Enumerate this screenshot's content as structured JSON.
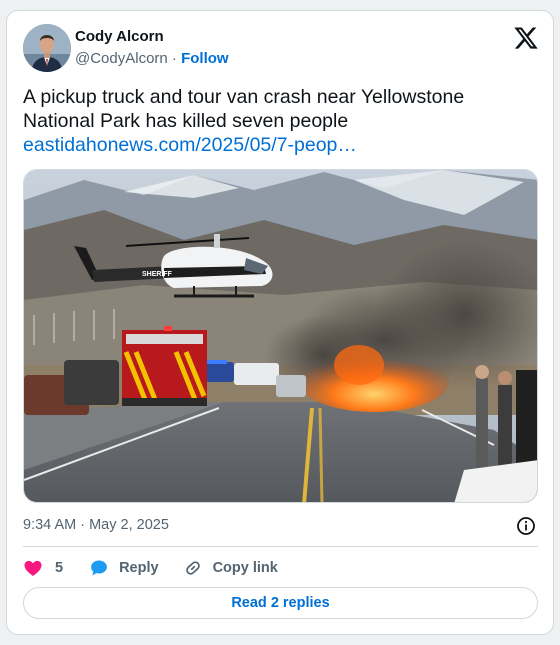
{
  "author": {
    "display_name": "Cody Alcorn",
    "handle": "@CodyAlcorn",
    "separator": " · ",
    "follow_label": "Follow"
  },
  "tweet": {
    "text": "A pickup truck and tour van crash near Yellowstone National Park has killed seven people",
    "link_text": "eastidahonews.com/2025/05/7-peop…"
  },
  "media": {
    "helicopter_text": "SHERIFF"
  },
  "meta": {
    "timestamp": "9:34 AM · May 2, 2025"
  },
  "actions": {
    "like_count": "5",
    "reply_label": "Reply",
    "copy_label": "Copy link"
  },
  "read_replies_label": "Read 2 replies",
  "icons": {
    "brand": "x-logo-icon",
    "like": "heart-icon",
    "reply": "speech-bubble-icon",
    "copy": "link-icon",
    "info": "info-icon"
  },
  "colors": {
    "link": "#006fd6",
    "like": "#f91880",
    "reply": "#1d9bf0",
    "muted": "#536471",
    "border": "#cfd9de"
  }
}
